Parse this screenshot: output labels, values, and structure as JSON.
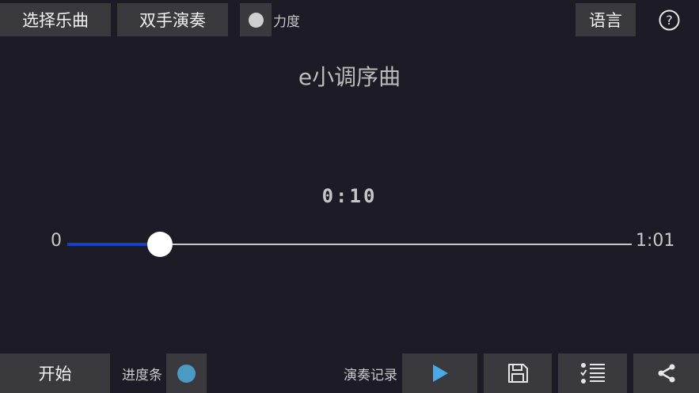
{
  "header": {
    "select_song_label": "选择乐曲",
    "two_hands_label": "双手演奏",
    "dynamics_label": "力度",
    "language_label": "语言",
    "help_icon": "question-circle-icon"
  },
  "main": {
    "song_title": "e小调序曲",
    "current_time": "0:10",
    "slider_min": "0",
    "slider_max": "1:01",
    "progress_fraction": 0.164
  },
  "footer": {
    "start_label": "开始",
    "progress_bar_label": "进度条",
    "records_label": "演奏记录",
    "play_icon": "play-icon",
    "save_icon": "save-icon",
    "list_icon": "checklist-icon",
    "share_icon": "share-icon"
  },
  "colors": {
    "background": "#1c1b26",
    "button": "#3a3a3e",
    "accent_blue": "#1640c8",
    "play_blue": "#4aa8e8",
    "toggle_dot": "#4a9ac4"
  }
}
